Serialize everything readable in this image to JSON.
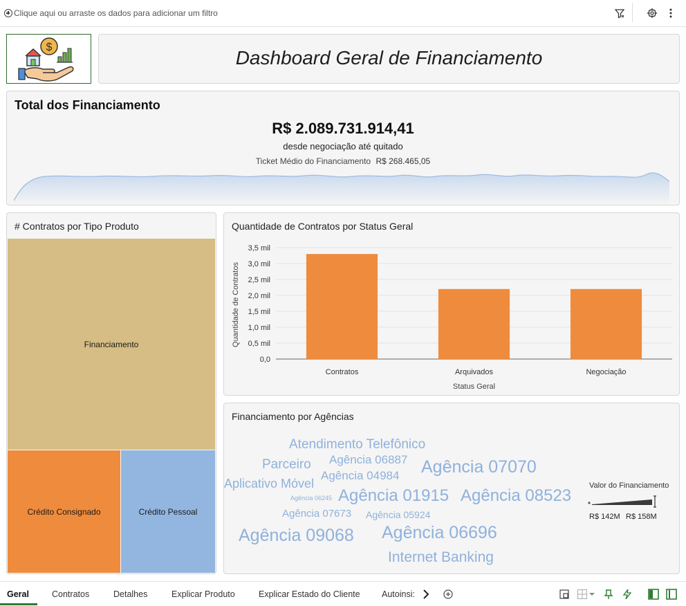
{
  "topbar": {
    "filter_hint": "Clique aqui ou arraste os dados para adicionar um filtro",
    "icons": [
      "add-filter-icon",
      "filter-icon",
      "settings-icon",
      "more-options-icon"
    ]
  },
  "header": {
    "title": "Dashboard Geral de Financiamento",
    "logo_icon": "finance-house-hand-icon"
  },
  "total": {
    "title": "Total dos Financiamento",
    "value": "R$ 2.089.731.914,41",
    "subtitle": "desde negociação até quitado",
    "ticket_label": "Ticket Médio do Financiamento",
    "ticket_value": "R$ 268.465,05"
  },
  "treemap": {
    "title": "# Contratos por Tipo Produto",
    "items": [
      {
        "label": "Financiamento",
        "color": "#d5bd85"
      },
      {
        "label": "Crédito Consignado",
        "color": "#ef8b3c"
      },
      {
        "label": "Crédito Pessoal",
        "color": "#92b6e0"
      }
    ]
  },
  "chart_data": {
    "type": "bar",
    "title": "Quantidade de Contratos por Status Geral",
    "xlabel": "Status Geral",
    "ylabel": "Quantidade de Contratos",
    "categories": [
      "Contratos",
      "Arquivados",
      "Negociação"
    ],
    "values": [
      3.3,
      2.2,
      2.2
    ],
    "value_unit": "mil",
    "ylim": [
      0,
      3.5
    ],
    "yticks": [
      "0,0",
      "0,5 mil",
      "1,0 mil",
      "1,5 mil",
      "2,0 mil",
      "2,5 mil",
      "3,0 mil",
      "3,5 mil"
    ],
    "grid": true,
    "bar_color": "#ef8b3c"
  },
  "cloud": {
    "title": "Financiamento por Agências",
    "word_color": "#8fb1dc",
    "words": [
      "Atendimento Telefônico",
      "Parceiro",
      "Agência 06887",
      "Agência 07070",
      "Agência 04984",
      "Aplicativo Móvel",
      "Agência 06245",
      "Agência 01915",
      "Agência 08523",
      "Agência 07673",
      "Agência 05924",
      "Agência 09068",
      "Agência 06696",
      "Internet Banking"
    ],
    "legend_title": "Valor do Financiamento",
    "legend_min": "R$ 142M",
    "legend_max": "R$ 158M"
  },
  "tabs": {
    "items": [
      "Geral",
      "Contratos",
      "Detalhes",
      "Explicar Produto",
      "Explicar Estado do Cliente",
      "Autoinsi:"
    ],
    "active": "Geral",
    "accent": "#2e7d32"
  }
}
